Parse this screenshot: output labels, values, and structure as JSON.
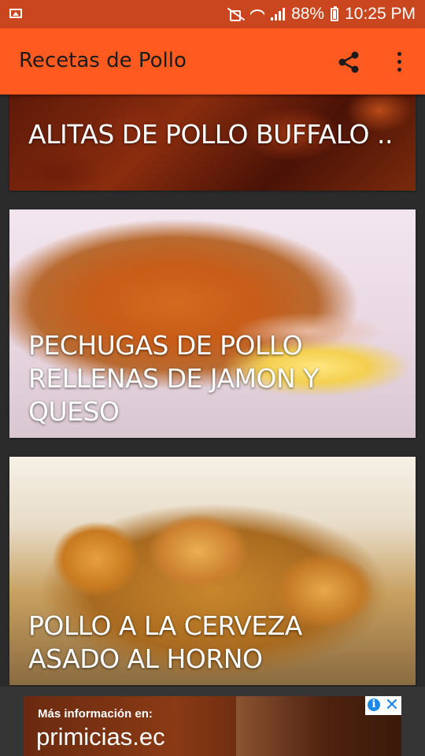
{
  "status_bar": {
    "battery": "88%",
    "time": "10:25 PM",
    "icons": [
      "image-icon",
      "mute-icon",
      "wifi-icon",
      "signal-icon",
      "battery-icon"
    ]
  },
  "app_bar": {
    "title": "Recetas de Pollo",
    "actions": [
      "share-icon",
      "more-vert-icon"
    ],
    "color": "#ff5a1f"
  },
  "recipes": [
    {
      "title": "ALITAS DE POLLO BUFFALO .."
    },
    {
      "title": "PECHUGAS DE POLLO RELLENAS DE JAMON Y QUESO"
    },
    {
      "title": "POLLO A LA CERVEZA ASADO AL HORNO"
    }
  ],
  "ad": {
    "line1": "Más información en:",
    "line2": "primicias.ec",
    "icons": [
      "info-icon",
      "close-icon"
    ]
  }
}
